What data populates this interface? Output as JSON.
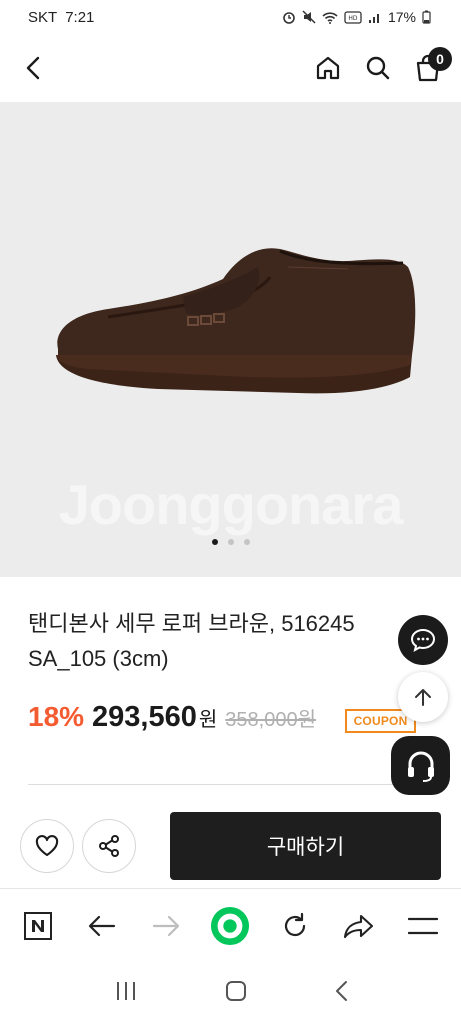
{
  "status_bar": {
    "carrier": "SKT",
    "time": "7:21",
    "battery": "17%"
  },
  "header": {
    "cart_count": "0"
  },
  "hero": {
    "watermark": "Joonggonara",
    "page_count": 3,
    "active_page": 1
  },
  "product": {
    "title": "탠디본사 세무 로퍼 브라운, 516245 SA_105 (3cm)",
    "discount": "18%",
    "price": "293,560",
    "currency": "원",
    "original_price": "358,000원",
    "coupon_label": "COUPON"
  },
  "actions": {
    "buy_label": "구매하기"
  },
  "colors": {
    "discount": "#f45b31",
    "coupon": "#f08a1d",
    "naver_green": "#03c75a",
    "dark": "#1e1e1e"
  }
}
